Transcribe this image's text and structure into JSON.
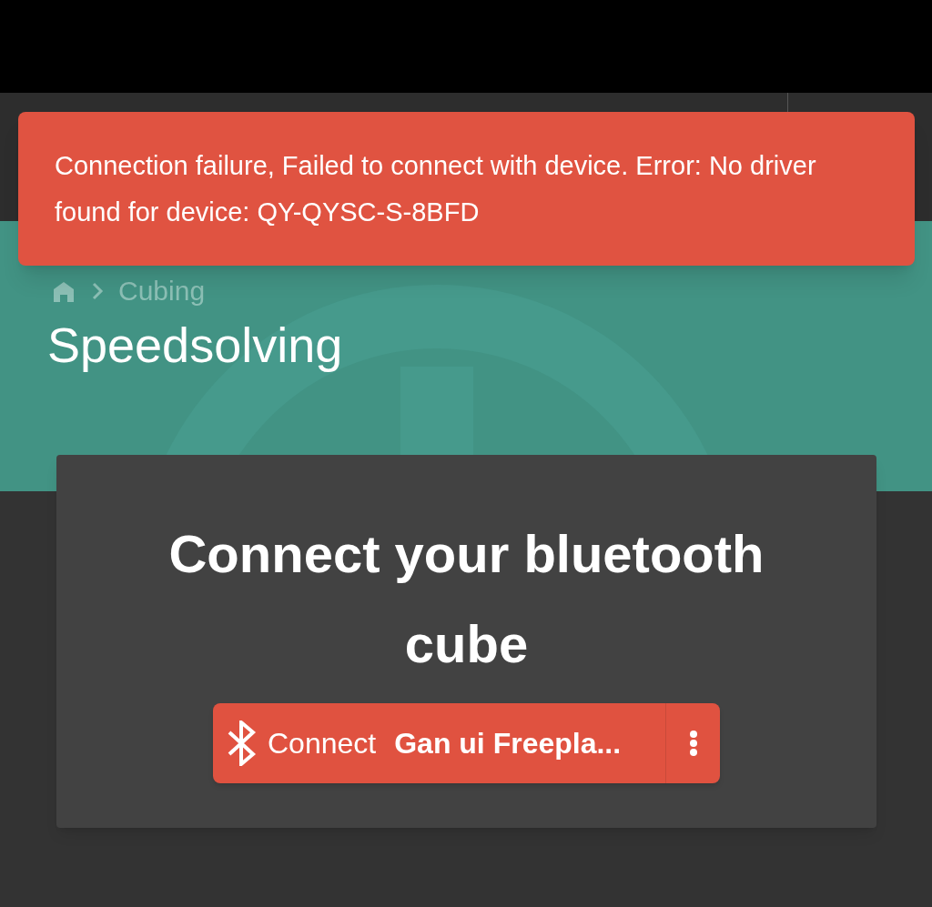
{
  "toast": {
    "message": "Connection failure, Failed to connect with device. Error: No driver found for device: QY-QYSC-S-8BFD"
  },
  "breadcrumb": [
    {
      "label": "Cubing"
    }
  ],
  "page_title": "Speedsolving",
  "card": {
    "title": "Connect your bluetooth cube",
    "button": {
      "label": "Connect",
      "device": "Gan ui Freepla..."
    }
  }
}
